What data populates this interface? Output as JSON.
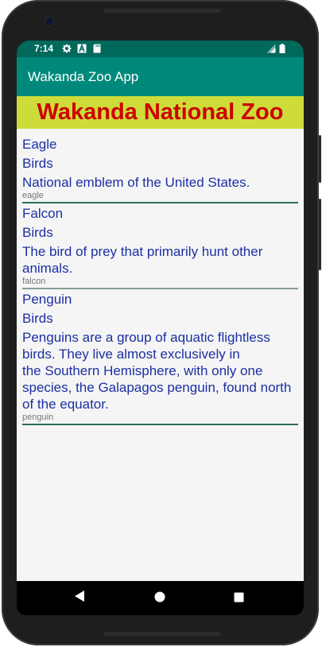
{
  "status_bar": {
    "time": "7:14",
    "icons": [
      "settings-icon",
      "a-icon",
      "sd-card-icon",
      "signal-icon",
      "battery-icon"
    ]
  },
  "app_bar": {
    "title": "Wakanda Zoo App",
    "color": "#00897b"
  },
  "header": {
    "title": "Wakanda National Zoo",
    "background": "#cddc39",
    "text_color": "#cc0000"
  },
  "animals": [
    {
      "name": "Eagle",
      "category": "Birds",
      "description": "National emblem of the United States.",
      "tag": "eagle"
    },
    {
      "name": "Falcon",
      "category": "Birds",
      "description_lines": [
        "The bird of prey that primarily hunt other",
        "animals."
      ],
      "tag": "falcon"
    },
    {
      "name": "Penguin",
      "category": "Birds",
      "description_lines": [
        "Penguins are a group of aquatic flightless",
        "birds. They live almost exclusively in",
        "the Southern Hemisphere, with only one",
        "species, the Galapagos penguin, found north",
        "of the equator."
      ],
      "tag": "penguin"
    }
  ],
  "nav": {
    "icons": [
      "back-icon",
      "home-icon",
      "recents-icon"
    ]
  }
}
